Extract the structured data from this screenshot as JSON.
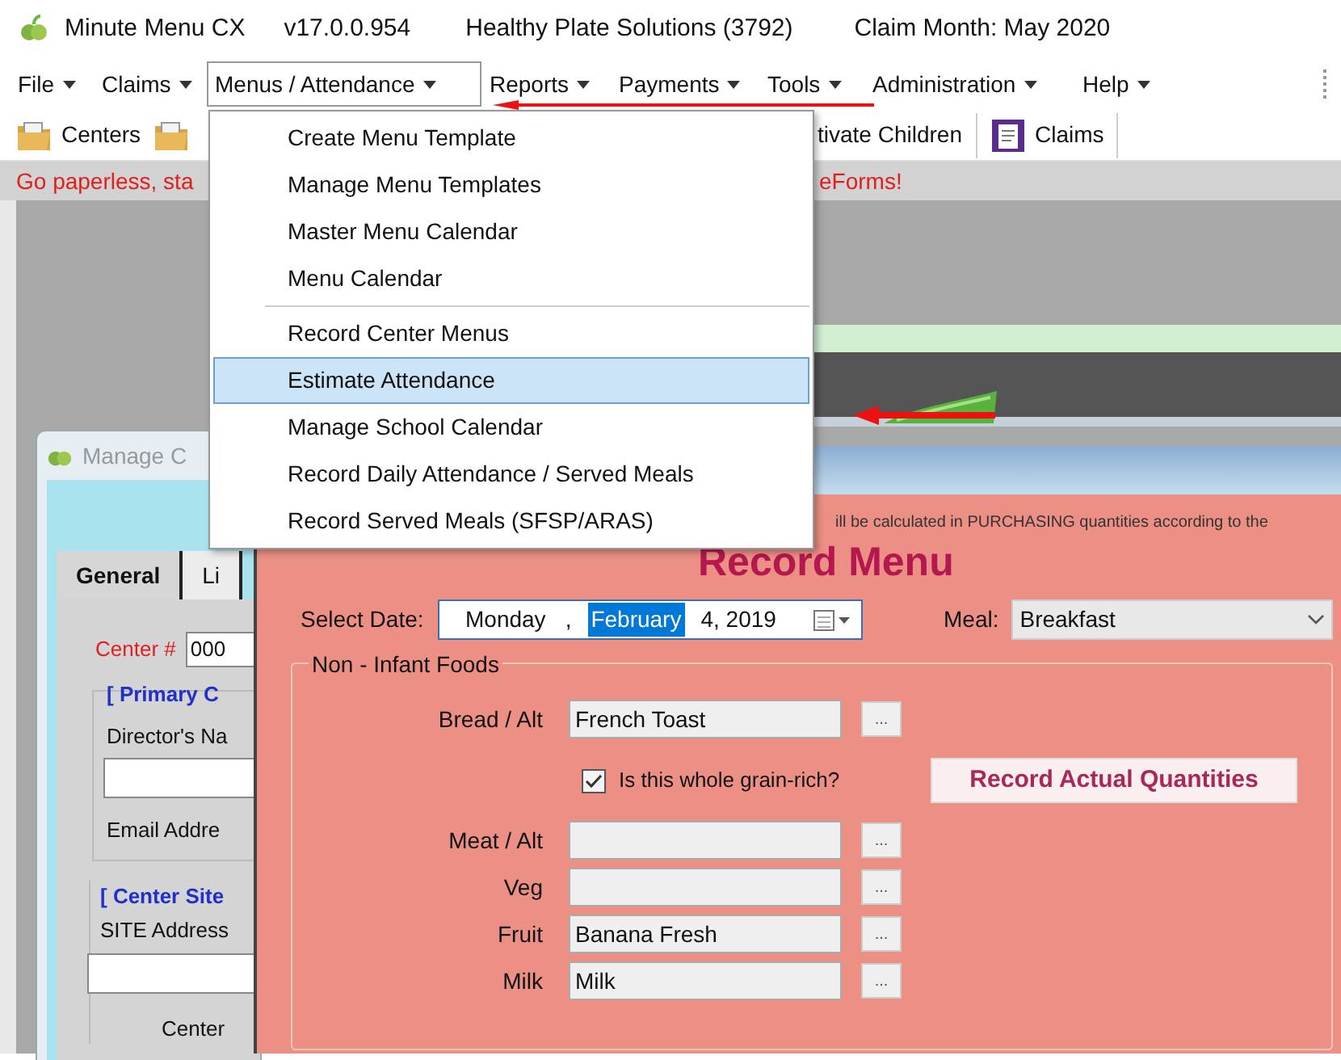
{
  "title_bar": {
    "app_name": "Minute Menu CX",
    "version": "v17.0.0.954",
    "organization": "Healthy Plate Solutions (3792)",
    "claim_month": "Claim Month: May 2020"
  },
  "menu_bar": [
    {
      "label": "File",
      "selected": false
    },
    {
      "label": "Claims",
      "selected": false
    },
    {
      "label": "Menus / Attendance",
      "selected": true
    },
    {
      "label": "Reports",
      "selected": false
    },
    {
      "label": "Payments",
      "selected": false
    },
    {
      "label": "Tools",
      "selected": false
    },
    {
      "label": "Administration",
      "selected": false
    },
    {
      "label": "Help",
      "selected": false
    }
  ],
  "dropdown_menu": [
    {
      "kind": "item",
      "label": "Create Menu Template",
      "selected": false
    },
    {
      "kind": "item",
      "label": "Manage Menu Templates",
      "selected": false
    },
    {
      "kind": "item",
      "label": "Master Menu Calendar",
      "selected": false
    },
    {
      "kind": "item",
      "label": "Menu Calendar",
      "selected": false
    },
    {
      "kind": "separator"
    },
    {
      "kind": "item",
      "label": "Record Center Menus",
      "selected": false
    },
    {
      "kind": "item",
      "label": "Estimate Attendance",
      "selected": true
    },
    {
      "kind": "item",
      "label": "Manage School Calendar",
      "selected": false
    },
    {
      "kind": "item",
      "label": "Record Daily Attendance / Served Meals",
      "selected": false
    },
    {
      "kind": "item",
      "label": "Record Served Meals (SFSP/ARAS)",
      "selected": false
    }
  ],
  "toolbar": {
    "left": [
      {
        "label": "Centers"
      }
    ],
    "right": [
      {
        "label": "tivate Children",
        "kind": "text"
      },
      {
        "label": "Claims",
        "kind": "document"
      }
    ]
  },
  "banner": {
    "left_text": "Go paperless, sta",
    "right_text": "eForms!"
  },
  "manage_window": {
    "title": "Manage C",
    "tabs": [
      {
        "label": "General",
        "selected": true
      },
      {
        "label": "Li",
        "selected": false
      }
    ],
    "center_label": "Center #",
    "center_value": "000",
    "primary_section": "[ Primary C",
    "director_label": "Director's Na",
    "email_label": "Email Addre",
    "site_section": "[ Center Site",
    "site_address_label": "SITE Address",
    "center_label_2": "Center"
  },
  "record_menu": {
    "notice": "ill be calculated in PURCHASING quantities according to the",
    "title": "Record Menu",
    "select_date_label": "Select Date:",
    "date_parts": [
      {
        "text": "Monday",
        "selected": false
      },
      {
        "text": ",",
        "selected": false
      },
      {
        "text": "February",
        "selected": true
      },
      {
        "text": "4, 2019",
        "selected": false
      }
    ],
    "meal_label": "Meal:",
    "meal_value": "Breakfast",
    "group_title": "Non - Infant Foods",
    "components": [
      {
        "label": "Bread / Alt",
        "value": "French Toast",
        "button": "..."
      },
      {
        "label": "Meat / Alt",
        "button": "..."
      },
      {
        "label": "Veg",
        "button": "..."
      },
      {
        "label": "Fruit",
        "value": "Banana Fresh",
        "button": "..."
      },
      {
        "label": "Milk",
        "value": "Milk",
        "button": "..."
      }
    ],
    "whole_grain": {
      "label": "Is this whole grain-rich?",
      "checked": true
    },
    "actual_quantities_button": "Record Actual Quantities"
  }
}
